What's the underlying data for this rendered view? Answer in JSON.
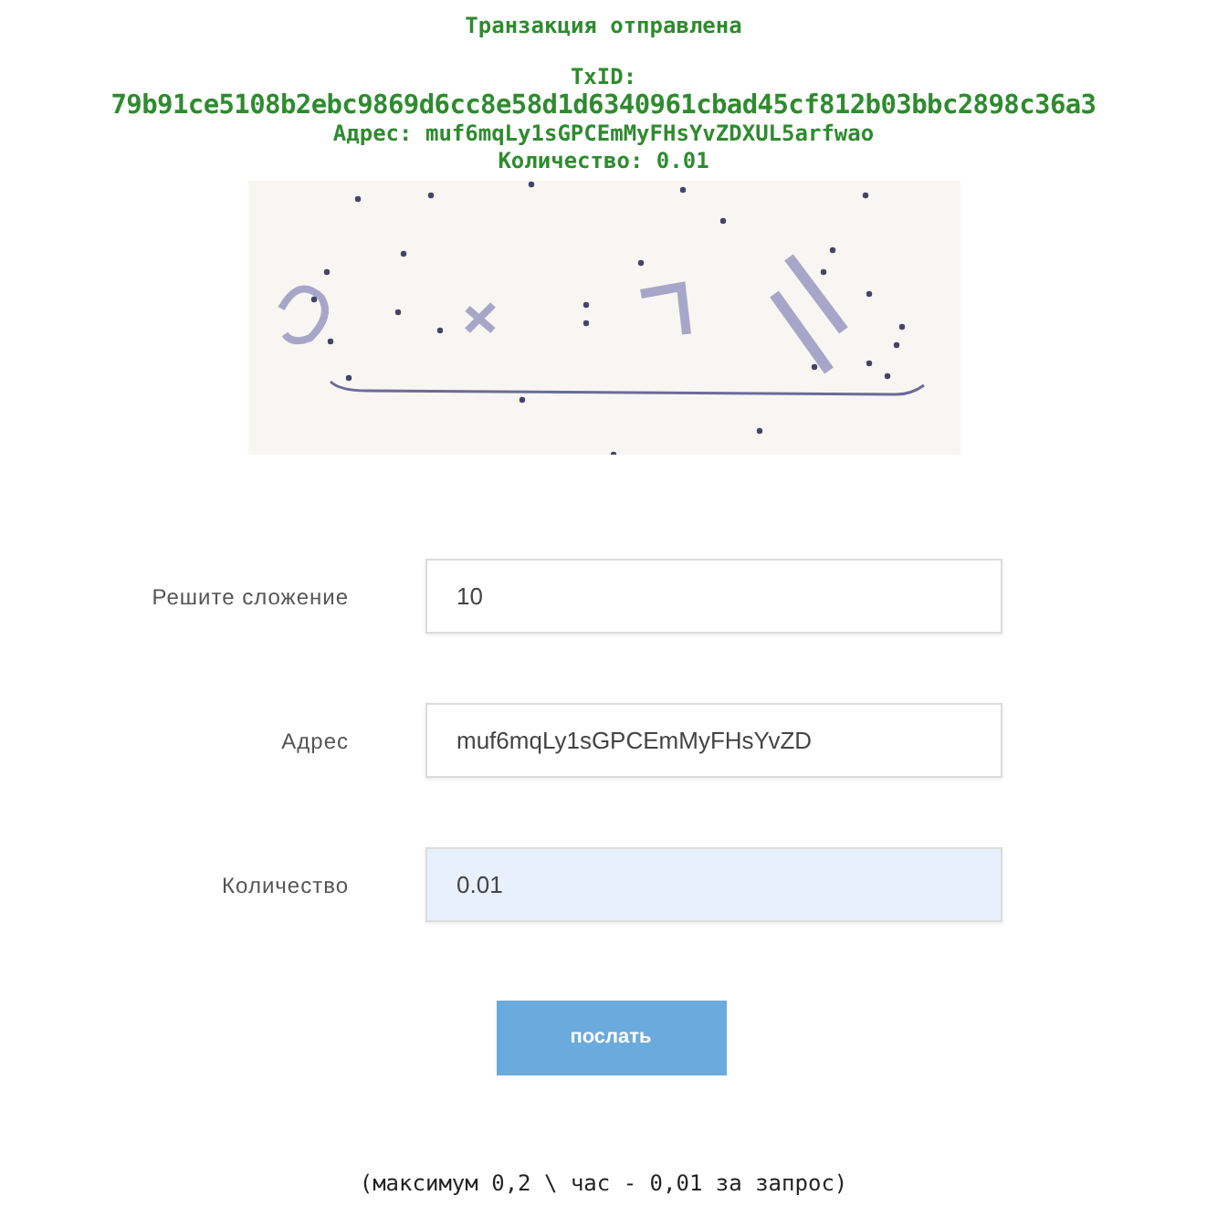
{
  "status_title": "Транзакция отправлена",
  "txid_label": "TxID:",
  "txid": "79b91ce5108b2ebc9869d6cc8e58d1d6340961cbad45cf812b03bbc2898c36a3",
  "address_line": "Адрес: muf6mqLy1sGPCEmMyFHsYvZDXUL5arfwao",
  "amount_line": "Количество: 0.01",
  "fields": [
    {
      "label": "Решите сложение",
      "value": "10",
      "autofilled": false
    },
    {
      "label": "Адрес",
      "value": "muf6mqLy1sGPCEmMyFHsYvZD",
      "autofilled": false
    },
    {
      "label": "Количество",
      "value": "0.01",
      "autofilled": true
    }
  ],
  "submit_button": "послать",
  "footer_note": "(максимум 0,2 \\ час - 0,01 за запрос)"
}
